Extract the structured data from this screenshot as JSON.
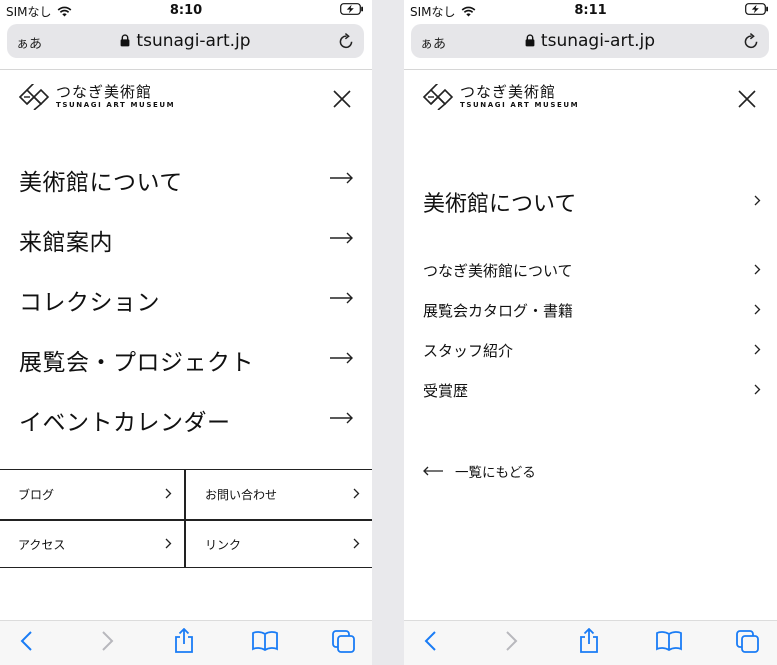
{
  "status_left": {
    "carrier": "SIMなし",
    "time": "8:10"
  },
  "status_right": {
    "carrier": "SIMなし",
    "time": "8:11"
  },
  "browser": {
    "aa": "ぁあ",
    "url": "tsunagi-art.jp"
  },
  "logo": {
    "jp": "つなぎ美術館",
    "en": "TSUNAGI ART MUSEUM"
  },
  "main_menu": [
    {
      "label": "美術館について"
    },
    {
      "label": "来館案内"
    },
    {
      "label": "コレクション"
    },
    {
      "label": "展覧会・プロジェクト"
    },
    {
      "label": "イベントカレンダー"
    }
  ],
  "sub_links": {
    "blog": "ブログ",
    "contact": "お問い合わせ",
    "access": "アクセス",
    "link": "リンク"
  },
  "submenu": {
    "title": "美術館について",
    "items": [
      {
        "label": "つなぎ美術館について"
      },
      {
        "label": "展覧会カタログ・書籍"
      },
      {
        "label": "スタッフ紹介"
      },
      {
        "label": "受賞歴"
      }
    ],
    "back": "一覧にもどる"
  },
  "colors": {
    "ios_blue": "#1a7cf5",
    "disabled": "#b8b8bd",
    "text": "#111111"
  },
  "icons": {
    "status": [
      "wifi-icon",
      "battery-charging-icon"
    ],
    "address": [
      "lock-icon",
      "reload-icon"
    ],
    "toolbar": [
      "back-icon",
      "forward-icon",
      "share-icon",
      "bookmarks-icon",
      "tabs-icon"
    ]
  }
}
